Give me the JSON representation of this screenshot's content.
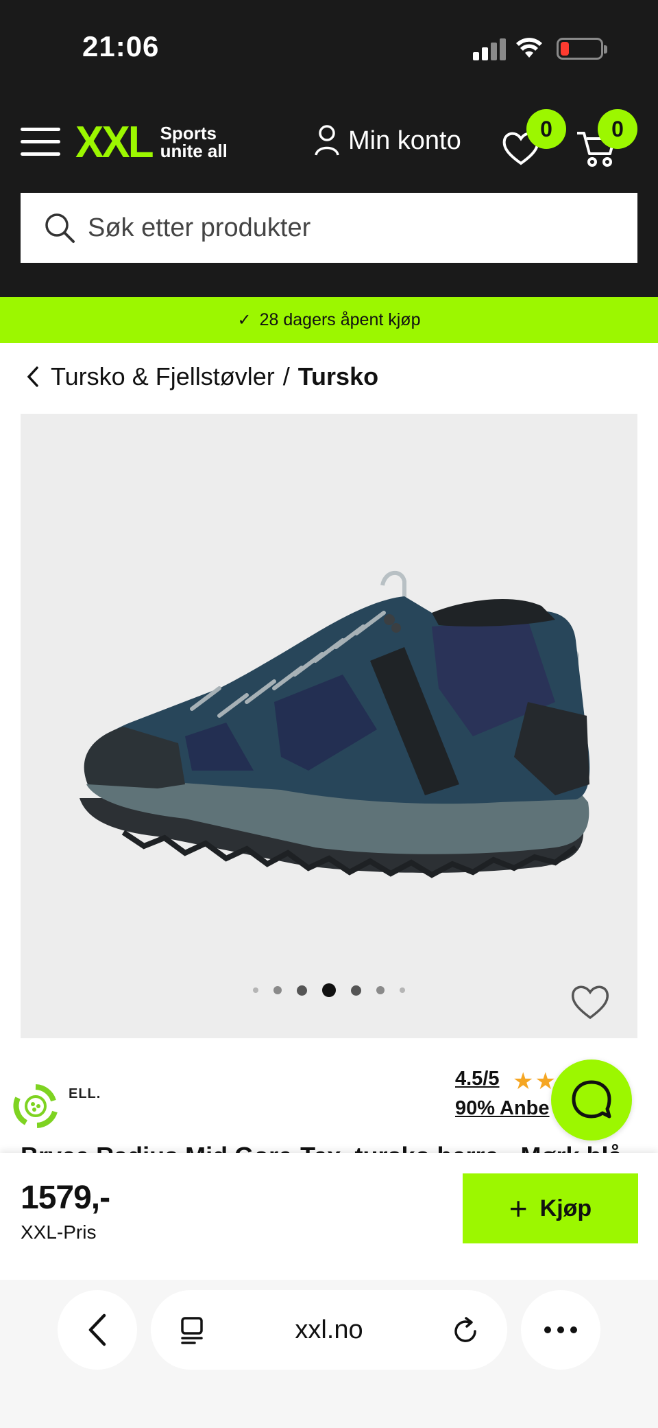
{
  "status_bar": {
    "time": "21:06"
  },
  "header": {
    "logo_text": "XXL",
    "logo_slogan_line1": "Sports",
    "logo_slogan_line2": "unite all",
    "account_label": "Min konto",
    "wishlist_count": "0",
    "cart_count": "0"
  },
  "search": {
    "placeholder": "Søk etter produkter"
  },
  "promo": {
    "text": "28 dagers åpent kjøp"
  },
  "breadcrumb": {
    "parent": "Tursko & Fjellstøvler",
    "separator": "/",
    "current": "Tursko"
  },
  "gallery": {
    "dot_count": 7,
    "active_dot": 3
  },
  "product": {
    "brand": "ELL.",
    "rating_score": "4.5/5",
    "rating_value": 4.5,
    "recommend": "90% Anbe",
    "title": "Bryce Radius Mid Gore-Tex, tursko herre - Mørk blå",
    "price": "1579,-",
    "price_label": "XXL-Pris",
    "buy_label": "Kjøp"
  },
  "browser": {
    "url": "xxl.no"
  },
  "colors": {
    "accent": "#9cf700",
    "header_bg": "#1a1a1a",
    "star": "#f5a623"
  }
}
